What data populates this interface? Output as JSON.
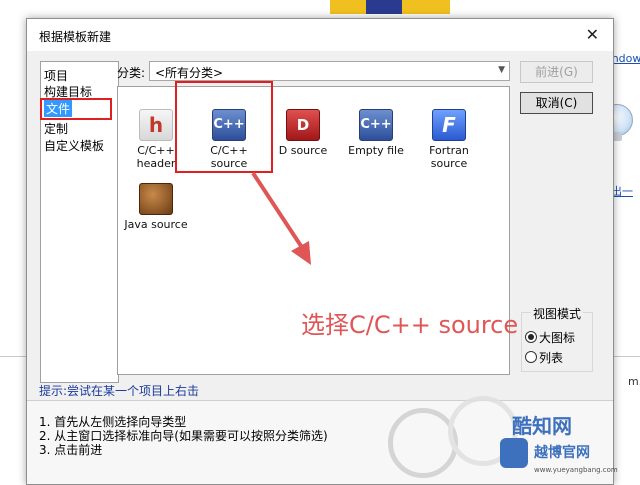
{
  "background": {
    "right_link_top": "Windows",
    "right_link_mid": "是出一个",
    "right_text_bottom": "m."
  },
  "dialog": {
    "title": "根据模板新建",
    "close_glyph": "✕"
  },
  "categories": [
    {
      "label": "项目"
    },
    {
      "label": "构建目标"
    },
    {
      "label": "文件",
      "selected": true
    },
    {
      "label": "定制"
    },
    {
      "label": "自定义模板"
    }
  ],
  "filter": {
    "label": "分类:",
    "value": "<所有分类>"
  },
  "templates": [
    {
      "icon": "h-header-icon",
      "glyph": "h",
      "label": "C/C++\nheader"
    },
    {
      "icon": "cpp-source-icon",
      "glyph": "C++",
      "label": "C/C++\nsource"
    },
    {
      "icon": "d-source-icon",
      "glyph": "D",
      "label": "D source"
    },
    {
      "icon": "empty-file-icon",
      "glyph": "C++",
      "label": "Empty file"
    },
    {
      "icon": "fortran-source-icon",
      "glyph": "F",
      "label": "Fortran\nsource"
    },
    {
      "icon": "java-source-icon",
      "glyph": "",
      "label": "Java source"
    }
  ],
  "annotation": {
    "text": "选择C/C++ source",
    "color": "#e05656"
  },
  "buttons": {
    "next": "前进(G)",
    "cancel": "取消(C)"
  },
  "view_mode": {
    "title": "视图模式",
    "large_icons": "大图标",
    "list": "列表",
    "selected": "大图标"
  },
  "hint": "提示:尝试在某一个项目上右击",
  "steps": [
    "1. 首先从左侧选择向导类型",
    "2. 从主窗口选择标准向导(如果需要可以按照分类筛选)",
    "3. 点击前进"
  ],
  "watermark": {
    "brand": "酷知网",
    "site_cn": "越博官网",
    "url": "www.yueyangbang.com"
  },
  "colors": {
    "highlight_box": "#e02020",
    "selection": "#3399ff",
    "hint_text": "#1a3a9a"
  }
}
